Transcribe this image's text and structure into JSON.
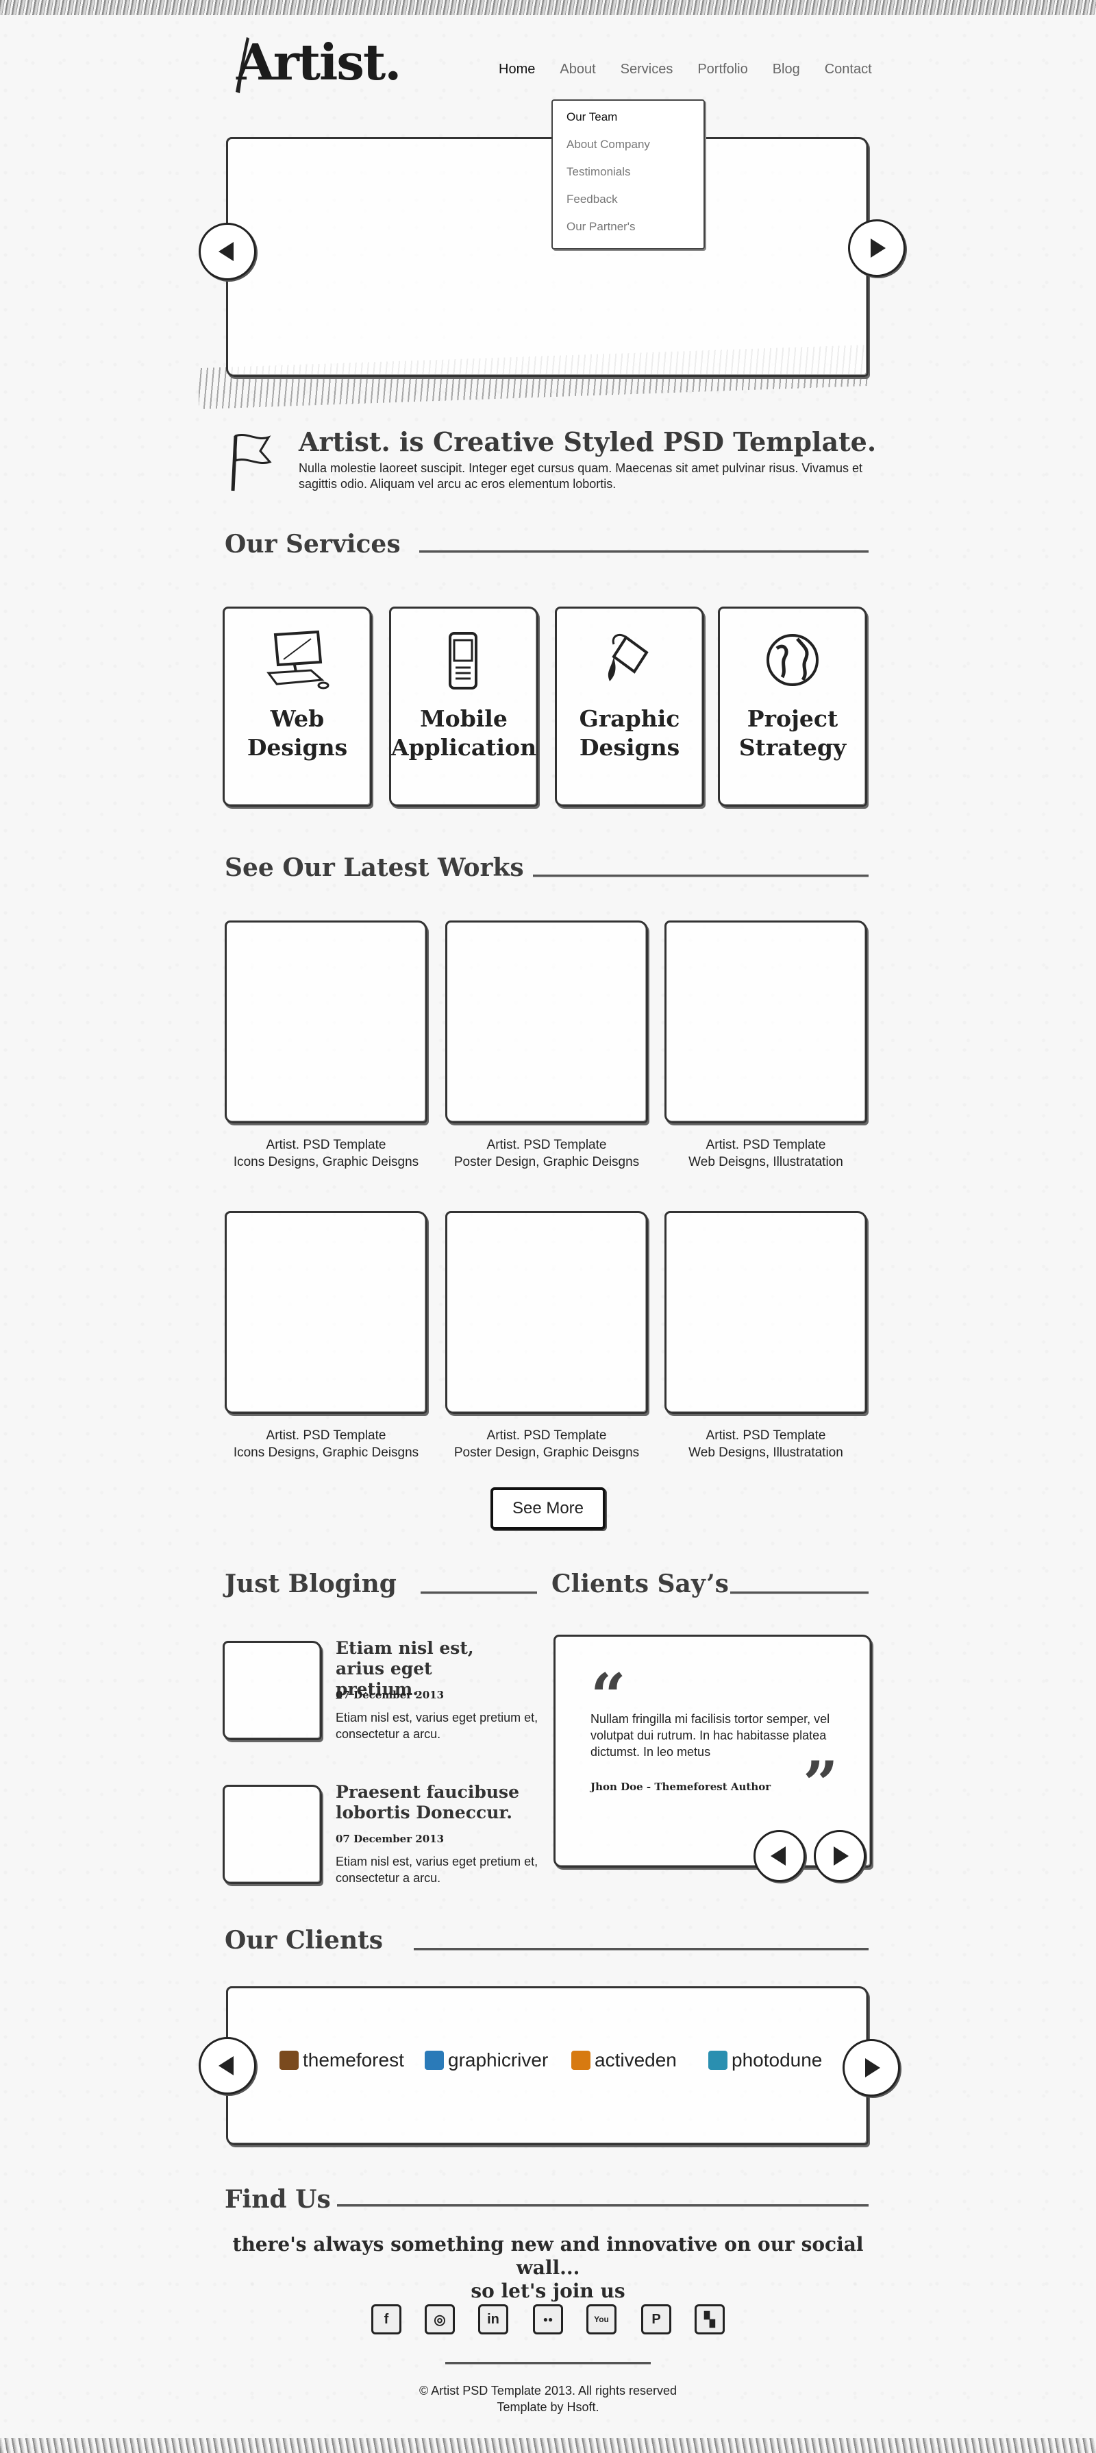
{
  "header": {
    "logo": "Artist.",
    "nav": [
      "Home",
      "About",
      "Services",
      "Portfolio",
      "Blog",
      "Contact"
    ],
    "dropdown": [
      "Our Team",
      "About Company",
      "Testimonials",
      "Feedback",
      "Our Partner's"
    ]
  },
  "intro": {
    "title": "Artist. is Creative Styled PSD Template.",
    "text": "Nulla molestie laoreet suscipit. Integer eget cursus quam. Maecenas sit amet pulvinar risus. Vivamus et sagittis odio. Aliquam vel arcu ac eros elementum lobortis."
  },
  "services": {
    "title": "Our Services",
    "items": [
      {
        "line1": "Web",
        "line2": "Designs",
        "icon": "computer-icon"
      },
      {
        "line1": "Mobile",
        "line2": "Application",
        "icon": "mobile-phone-icon"
      },
      {
        "line1": "Graphic",
        "line2": "Designs",
        "icon": "paint-bucket-icon"
      },
      {
        "line1": "Project",
        "line2": "Strategy",
        "icon": "globe-icon"
      }
    ]
  },
  "works": {
    "title": "See Our Latest Works",
    "items": [
      {
        "title": "Artist. PSD Template",
        "tags": "Icons Designs, Graphic Deisgns"
      },
      {
        "title": "Artist. PSD Template",
        "tags": "Poster Design, Graphic Deisgns"
      },
      {
        "title": "Artist. PSD Template",
        "tags": "Web Deisgns, Illustratation"
      },
      {
        "title": "Artist. PSD Template",
        "tags": "Icons Designs, Graphic Deisgns"
      },
      {
        "title": "Artist. PSD Template",
        "tags": "Poster Design, Graphic Deisgns"
      },
      {
        "title": "Artist. PSD Template",
        "tags": "Web Designs, Illustratation"
      }
    ],
    "see_more": "See More"
  },
  "blog": {
    "title": "Just Bloging",
    "posts": [
      {
        "title": "Etiam nisl est, arius eget pretium.",
        "date": "07 December 2013",
        "text": "Etiam nisl est, varius eget pretium et, consectetur a arcu."
      },
      {
        "title": "Praesent faucibuse lobortis Doneccur.",
        "date": "07 December 2013",
        "text": "Etiam nisl est, varius eget pretium et, consectetur a arcu."
      }
    ]
  },
  "testimonial": {
    "title": "Clients Say’s",
    "open_quote": "“",
    "close_quote": "”",
    "text": "Nullam fringilla mi facilisis tortor semper, vel volutpat dui rutrum. In hac habitasse platea dictumst. In leo metus",
    "author": "Jhon Doe - Themeforest Author"
  },
  "clients": {
    "title": "Our Clients",
    "items": [
      {
        "name": "themeforest",
        "color": "#7a4a1e"
      },
      {
        "name": "graphicriver",
        "color": "#2a7ab8"
      },
      {
        "name": "activeden",
        "color": "#d77a10"
      },
      {
        "name": "photodune",
        "color": "#2a8fb0"
      }
    ]
  },
  "find_us": {
    "title": "Find Us",
    "line1": "there's always something new and innovative on our social wall...",
    "line2": "so let's join us",
    "social": [
      {
        "icon": "facebook-icon",
        "glyph": "f"
      },
      {
        "icon": "dribbble-icon",
        "glyph": "◎"
      },
      {
        "icon": "linkedin-icon",
        "glyph": "in"
      },
      {
        "icon": "flickr-icon",
        "glyph": "●●"
      },
      {
        "icon": "youtube-icon",
        "glyph": "You"
      },
      {
        "icon": "pinterest-icon",
        "glyph": "P"
      },
      {
        "icon": "delicious-icon",
        "glyph": "▚"
      }
    ]
  },
  "footer": {
    "line1": "© Artist PSD Template 2013. All rights reserved",
    "line2": "Template by Hsoft."
  }
}
